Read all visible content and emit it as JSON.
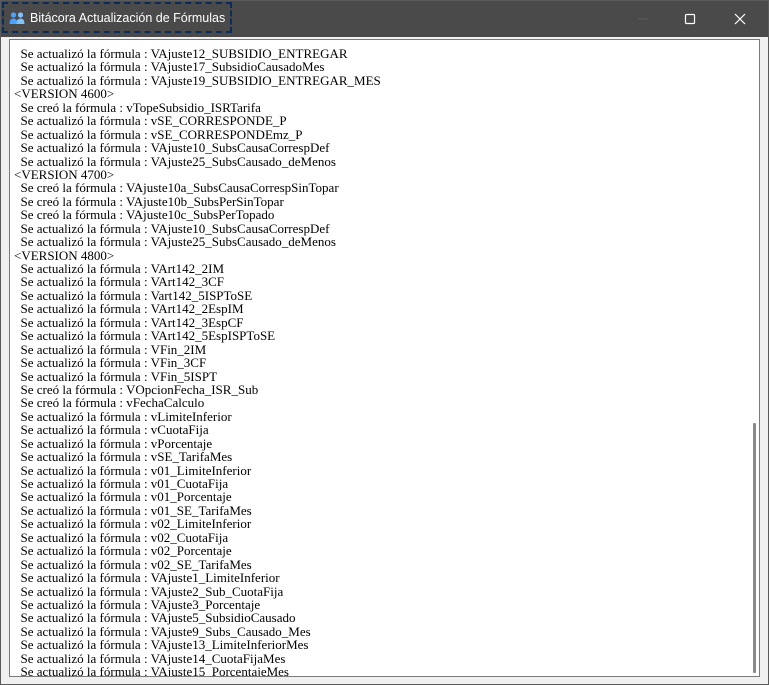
{
  "window": {
    "title": "Bitácora Actualización de Fórmulas",
    "app_icon": "people-icon",
    "buttons": {
      "minimize": "minimize-icon",
      "maximize": "maximize-icon",
      "close": "close-icon"
    }
  },
  "log": {
    "lines": [
      "  Se actualizó la fórmula : VAjuste12_SUBSIDIO_ENTREGAR",
      "  Se actualizó la fórmula : VAjuste17_SubsidioCausadoMes",
      "  Se actualizó la fórmula : VAjuste19_SUBSIDIO_ENTREGAR_MES",
      "<VERSION 4600>",
      "  Se creó la fórmula : vTopeSubsidio_ISRTarifa",
      "  Se actualizó la fórmula : vSE_CORRESPONDE_P",
      "  Se actualizó la fórmula : vSE_CORRESPONDEmz_P",
      "  Se actualizó la fórmula : VAjuste10_SubsCausaCorrespDef",
      "  Se actualizó la fórmula : VAjuste25_SubsCausado_deMenos",
      "<VERSION 4700>",
      "  Se creó la fórmula : VAjuste10a_SubsCausaCorrespSinTopar",
      "  Se creó la fórmula : VAjuste10b_SubsPerSinTopar",
      "  Se creó la fórmula : VAjuste10c_SubsPerTopado",
      "  Se actualizó la fórmula : VAjuste10_SubsCausaCorrespDef",
      "  Se actualizó la fórmula : VAjuste25_SubsCausado_deMenos",
      "<VERSION 4800>",
      "  Se actualizó la fórmula : VArt142_2IM",
      "  Se actualizó la fórmula : VArt142_3CF",
      "  Se actualizó la fórmula : Vart142_5ISPToSE",
      "  Se actualizó la fórmula : VArt142_2EspIM",
      "  Se actualizó la fórmula : VArt142_3EspCF",
      "  Se actualizó la fórmula : VArt142_5EspISPToSE",
      "  Se actualizó la fórmula : VFin_2IM",
      "  Se actualizó la fórmula : VFin_3CF",
      "  Se actualizó la fórmula : VFin_5ISPT",
      "  Se creó la fórmula : VOpcionFecha_ISR_Sub",
      "  Se creó la fórmula : vFechaCalculo",
      "  Se actualizó la fórmula : vLimiteInferior",
      "  Se actualizó la fórmula : vCuotaFija",
      "  Se actualizó la fórmula : vPorcentaje",
      "  Se actualizó la fórmula : vSE_TarifaMes",
      "  Se actualizó la fórmula : v01_LimiteInferior",
      "  Se actualizó la fórmula : v01_CuotaFija",
      "  Se actualizó la fórmula : v01_Porcentaje",
      "  Se actualizó la fórmula : v01_SE_TarifaMes",
      "  Se actualizó la fórmula : v02_LimiteInferior",
      "  Se actualizó la fórmula : v02_CuotaFija",
      "  Se actualizó la fórmula : v02_Porcentaje",
      "  Se actualizó la fórmula : v02_SE_TarifaMes",
      "  Se actualizó la fórmula : VAjuste1_LimiteInferior",
      "  Se actualizó la fórmula : VAjuste2_Sub_CuotaFija",
      "  Se actualizó la fórmula : VAjuste3_Porcentaje",
      "  Se actualizó la fórmula : VAjuste5_SubsidioCausado",
      "  Se actualizó la fórmula : VAjuste9_Subs_Causado_Mes",
      "  Se actualizó la fórmula : VAjuste13_LimiteInferiorMes",
      "  Se actualizó la fórmula : VAjuste14_CuotaFijaMes",
      "  Se actualizó la fórmula : VAjuste15_PorcentajeMes"
    ]
  },
  "colors": {
    "titlebar": "#4a4a4a",
    "title_text": "#ffffff",
    "focus_outline": "#0a2c5a",
    "log_text": "#000000",
    "client_bg": "#ffffff"
  }
}
